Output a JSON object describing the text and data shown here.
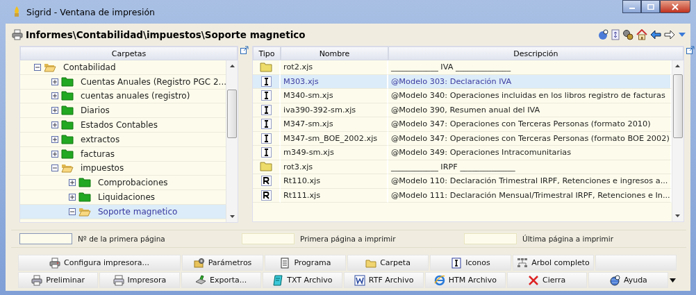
{
  "window": {
    "title": "Sigrid - Ventana de impresión"
  },
  "path": "Informes\\Contabilidad\\impuestos\\Soporte magnetico",
  "tree": {
    "header": "Carpetas",
    "items": [
      {
        "label": "Contabilidad",
        "expanded": true,
        "selected": false,
        "children": [
          {
            "label": "Cuentas Anuales (Registro PGC 2...",
            "expanded": false,
            "selected": false
          },
          {
            "label": "cuentas anuales (registro)",
            "expanded": false,
            "selected": false
          },
          {
            "label": "Diarios",
            "expanded": false,
            "selected": false
          },
          {
            "label": "Estados Contables",
            "expanded": false,
            "selected": false
          },
          {
            "label": "extractos",
            "expanded": false,
            "selected": false
          },
          {
            "label": "facturas",
            "expanded": false,
            "selected": false
          },
          {
            "label": "impuestos",
            "expanded": true,
            "selected": false,
            "children": [
              {
                "label": "Comprobaciones",
                "expanded": false,
                "selected": false
              },
              {
                "label": "Liquidaciones",
                "expanded": false,
                "selected": false
              },
              {
                "label": "Soporte magnetico",
                "expanded": true,
                "selected": true
              }
            ]
          }
        ]
      }
    ]
  },
  "table": {
    "columns": [
      "Tipo",
      "Nombre",
      "Descripción"
    ],
    "rows": [
      {
        "kind": "folder",
        "name": "rot2.xjs",
        "description": "____________  IVA  ______________",
        "selected": false
      },
      {
        "kind": "i",
        "name": "M303.xjs",
        "description": "@Modelo 303: Declaración IVA",
        "selected": true
      },
      {
        "kind": "i",
        "name": "M340-sm.xjs",
        "description": "@Modelo 340: Operaciones incluidas en los libros registro de facturas",
        "selected": false
      },
      {
        "kind": "i",
        "name": "iva390-392-sm.xjs",
        "description": "@Modelo 390, Resumen anual del IVA",
        "selected": false
      },
      {
        "kind": "i",
        "name": "M347-sm.xjs",
        "description": "@Modelo 347: Operaciones con Terceras Personas (formato 2010)",
        "selected": false
      },
      {
        "kind": "i",
        "name": "M347-sm_BOE_2002.xjs",
        "description": "@Modelo 347: Operaciones con Terceras Personas (formato BOE 2002)",
        "selected": false
      },
      {
        "kind": "i",
        "name": "m349-sm.xjs",
        "description": "@Modelo 349: Operaciones Intracomunitarias",
        "selected": false
      },
      {
        "kind": "folder",
        "name": "rot3.xjs",
        "description": "____________  IRPF  ______________",
        "selected": false
      },
      {
        "kind": "r",
        "name": "Rt110.xjs",
        "description": "@Modelo 110: Declaración Trimestral IRPF, Retenciones e ingresos a...",
        "selected": false
      },
      {
        "kind": "r",
        "name": "Rt111.xjs",
        "description": "@Modelo 111: Declaración Mensual/Trimestral IRPF, Retenciones e In...",
        "selected": false
      }
    ]
  },
  "page_fields": [
    {
      "label": "Nº de la primera página"
    },
    {
      "label": "Primera página a imprimir"
    },
    {
      "label": "Última página a imprimir"
    }
  ],
  "button_rows": [
    [
      "Configura impresora...",
      "Parámetros",
      "Programa",
      "Carpeta",
      "Iconos",
      "Arbol completo"
    ],
    [
      "Preliminar",
      "Impresora",
      "Exporta...",
      "TXT Archivo",
      "RTF Archivo",
      "HTM Archivo",
      "Cierra",
      "Ayuda"
    ]
  ]
}
